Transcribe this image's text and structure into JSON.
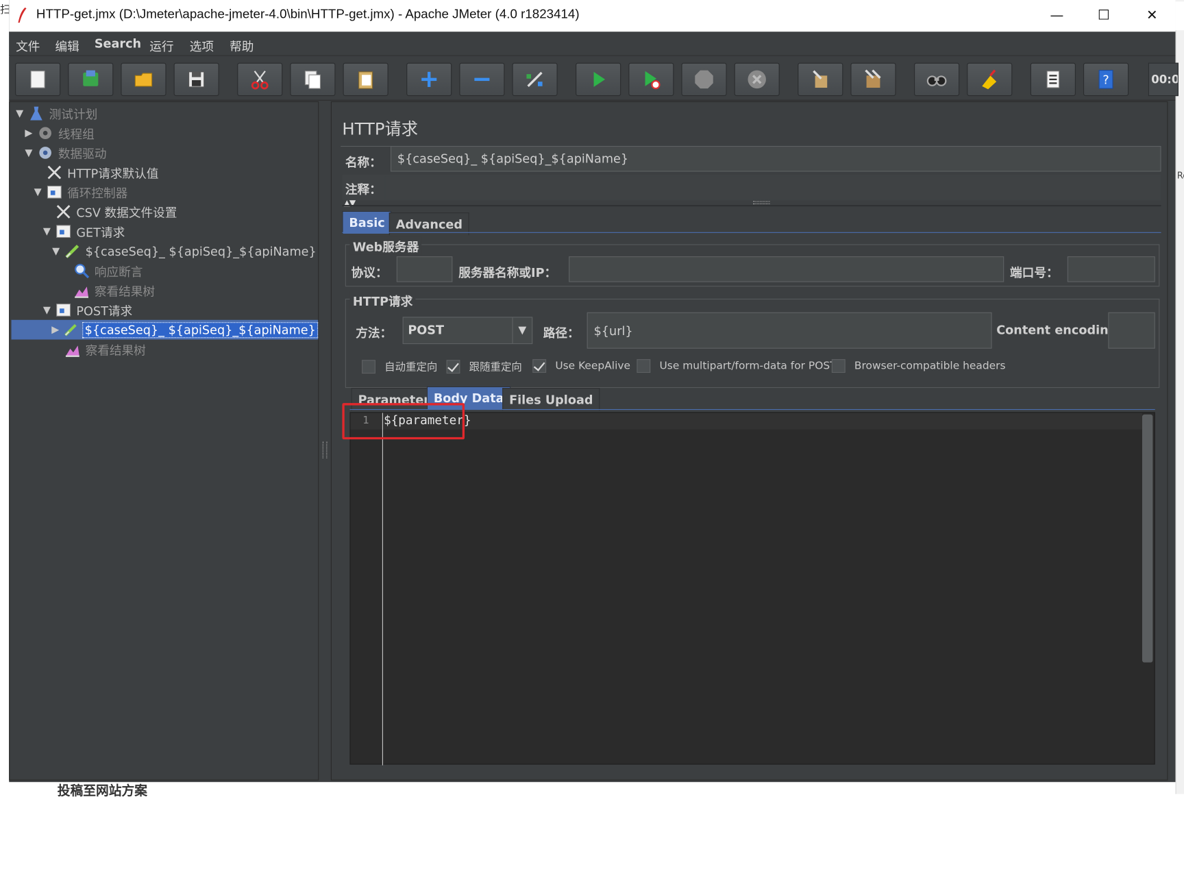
{
  "window": {
    "title": "HTTP-get.jmx (D:\\Jmeter\\apache-jmeter-4.0\\bin\\HTTP-get.jmx) - Apache JMeter (4.0 r1823414)",
    "minimize_glyph": "—",
    "maximize_glyph": "☐",
    "close_glyph": "✕"
  },
  "background": {
    "corner_char": "扫",
    "right_edge_text": "Re",
    "bottom_text": "投稿至网站方案"
  },
  "menu": [
    "文件",
    "编辑",
    "Search",
    "运行",
    "选项",
    "帮助"
  ],
  "toolbar": {
    "buttons": [
      "new-icon",
      "templates-icon",
      "open-icon",
      "save-icon",
      "cut-icon",
      "copy-icon",
      "paste-icon",
      "expand-icon",
      "collapse-icon",
      "toggle-icon",
      "start-icon",
      "start-no-timers-icon",
      "stop-icon",
      "shutdown-icon",
      "clear-icon",
      "clear-all-icon",
      "search-icon",
      "reset-search-icon",
      "function-helper-icon",
      "help-icon"
    ],
    "timer": "00:0"
  },
  "tree": [
    {
      "label": "测试计划",
      "toggle": "▼",
      "icon": "test-plan-icon",
      "disabled": true
    },
    {
      "label": "线程组",
      "toggle": "▶",
      "icon": "thread-group-icon",
      "disabled": true
    },
    {
      "label": "数据驱动",
      "toggle": "▼",
      "icon": "thread-group-icon",
      "disabled": true
    },
    {
      "label": "HTTP请求默认值",
      "toggle": "",
      "icon": "config-icon",
      "disabled": false
    },
    {
      "label": "循环控制器",
      "toggle": "▼",
      "icon": "controller-icon",
      "disabled": true
    },
    {
      "label": "CSV 数据文件设置",
      "toggle": "",
      "icon": "config-icon",
      "disabled": false
    },
    {
      "label": "GET请求",
      "toggle": "▼",
      "icon": "controller-icon",
      "disabled": false
    },
    {
      "label": "${caseSeq}_ ${apiSeq}_${apiName}",
      "toggle": "▼",
      "icon": "sampler-icon",
      "disabled": false
    },
    {
      "label": "响应断言",
      "toggle": "",
      "icon": "assertion-icon",
      "disabled": true
    },
    {
      "label": "察看结果树",
      "toggle": "",
      "icon": "listener-icon",
      "disabled": true
    },
    {
      "label": "POST请求",
      "toggle": "▼",
      "icon": "controller-icon",
      "disabled": false
    },
    {
      "label": "${caseSeq}_ ${apiSeq}_${apiName}",
      "toggle": "▶",
      "icon": "sampler-icon",
      "disabled": false,
      "selected": true
    },
    {
      "label": "察看结果树",
      "toggle": "",
      "icon": "listener-icon",
      "disabled": true
    }
  ],
  "panel": {
    "title": "HTTP请求",
    "name_label": "名称：",
    "name_value": "${caseSeq}_ ${apiSeq}_${apiName}",
    "comment_label": "注释：",
    "comment_value": "",
    "collapse_arrows": "▲▼",
    "tabs": [
      {
        "label": "Basic",
        "active": true
      },
      {
        "label": "Advanced",
        "active": false
      }
    ],
    "web_server": {
      "title": "Web服务器",
      "protocol_label": "协议：",
      "protocol_value": "",
      "server_label": "服务器名称或IP：",
      "server_value": "",
      "port_label": "端口号：",
      "port_value": ""
    },
    "http_request": {
      "title": "HTTP请求",
      "method_label": "方法：",
      "method_value": "POST",
      "path_label": "路径：",
      "path_value": "${url}",
      "encoding_label": "Content encoding:",
      "encoding_value": ""
    },
    "checkboxes": [
      {
        "label": "自动重定向",
        "checked": false
      },
      {
        "label": "跟随重定向",
        "checked": true
      },
      {
        "label": "Use KeepAlive",
        "checked": true
      },
      {
        "label": "Use multipart/form-data for POST",
        "checked": false
      },
      {
        "label": "Browser-compatible headers",
        "checked": false
      }
    ],
    "body_tabs": [
      {
        "label": "Parameters",
        "active": false
      },
      {
        "label": "Body Data",
        "active": true
      },
      {
        "label": "Files Upload",
        "active": false
      }
    ],
    "editor": {
      "line_number": "1",
      "code": "${parameter}"
    }
  },
  "colors": {
    "background": "#3c3f41",
    "selection": "#4b6eaf",
    "highlight_annotation": "#e0282c"
  }
}
